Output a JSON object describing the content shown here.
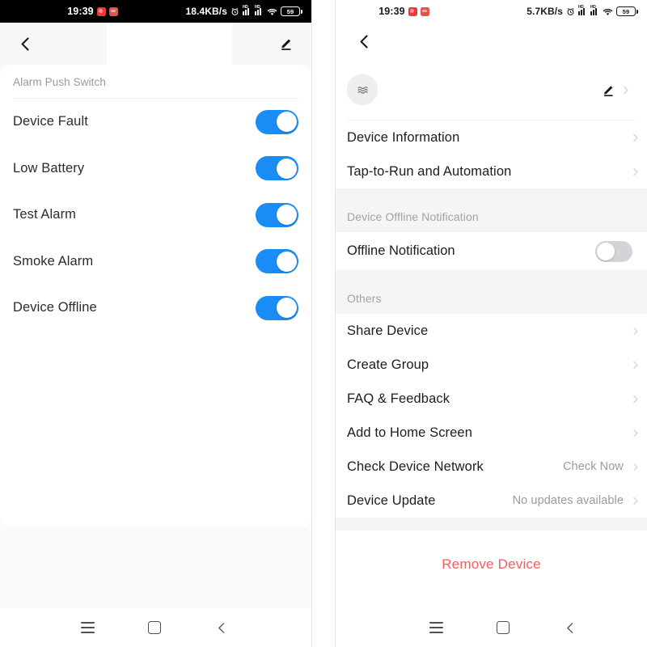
{
  "left_phone": {
    "statusbar": {
      "time": "19:39",
      "network_speed": "18.4KB/s",
      "battery_level": "59",
      "app_badges": [
        "notification-badge-red",
        "notification-badge-red-2"
      ],
      "icons": [
        "alarm-icon",
        "signal-hd-icon",
        "signal-hd-icon-2",
        "wifi-icon",
        "battery-icon"
      ]
    },
    "header": {
      "back_label": "‹",
      "edit_label": "edit"
    },
    "section_label": "Alarm Push Switch",
    "switches": [
      {
        "label": "Device Fault",
        "state": "on"
      },
      {
        "label": "Low Battery",
        "state": "on"
      },
      {
        "label": "Test Alarm",
        "state": "on"
      },
      {
        "label": "Smoke Alarm",
        "state": "on"
      },
      {
        "label": "Device Offline",
        "state": "on"
      }
    ],
    "navbar": {
      "recents": "recents",
      "home": "home",
      "back": "back"
    }
  },
  "right_phone": {
    "statusbar": {
      "time": "19:39",
      "network_speed": "5.7KB/s",
      "battery_level": "59",
      "app_badges": [
        "notification-badge-red",
        "notification-badge-red-2"
      ],
      "icons": [
        "alarm-icon",
        "signal-hd-icon",
        "signal-hd-icon-2",
        "wifi-icon",
        "battery-icon"
      ]
    },
    "header": {
      "back_label": "‹"
    },
    "device_strip": {
      "avatar_icon": "smoke-waves-icon",
      "edit_label": "edit",
      "chevron": "›"
    },
    "top_menu": [
      {
        "label": "Device Information",
        "value": "",
        "chevron": "›"
      },
      {
        "label": "Tap-to-Run and Automation",
        "value": "",
        "chevron": "›"
      }
    ],
    "offline_section": {
      "title": "Device Offline Notification",
      "row": {
        "label": "Offline Notification",
        "state": "off"
      }
    },
    "others_section": {
      "title": "Others",
      "items": [
        {
          "label": "Share Device",
          "value": "",
          "chevron": "›"
        },
        {
          "label": "Create Group",
          "value": "",
          "chevron": "›"
        },
        {
          "label": "FAQ & Feedback",
          "value": "",
          "chevron": "›"
        },
        {
          "label": "Add to Home Screen",
          "value": "",
          "chevron": "›"
        },
        {
          "label": "Check Device Network",
          "value": "Check Now",
          "chevron": "›"
        },
        {
          "label": "Device Update",
          "value": "No updates available",
          "chevron": "›"
        }
      ]
    },
    "remove_device_label": "Remove Device",
    "navbar": {
      "recents": "recents",
      "home": "home",
      "back": "back"
    }
  },
  "colors": {
    "toggle_on": "#1a8cf5",
    "toggle_off": "#d3d4d8",
    "remove_red": "#f0605e",
    "section_bg": "#f4f5f7",
    "muted_text": "#9b9b9f"
  }
}
